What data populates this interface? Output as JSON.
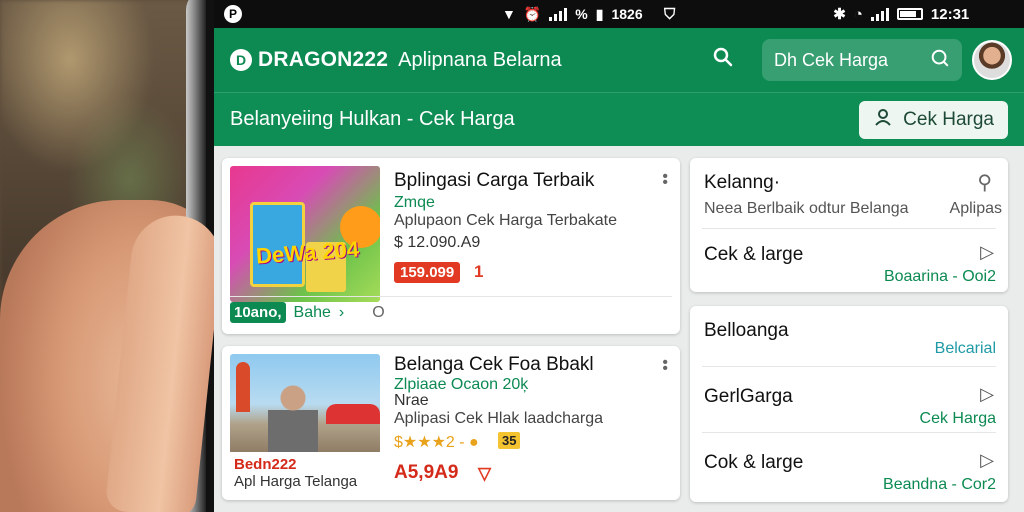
{
  "status": {
    "left_icon": "p-app-icon",
    "center_time": "1826",
    "right_time": "12:31"
  },
  "appbar": {
    "logo_letter": "D",
    "brand": "DRAGON222",
    "subtitle": "Aplipnana Belarna",
    "search_placeholder": "Dh Cek Harga"
  },
  "subbar": {
    "title": "Belanyeiing Hulkan - Cek Harga",
    "button_label": "Cek Harga"
  },
  "products": [
    {
      "title": "Bplingasi Carga Terbaik",
      "sub": "Zmqe",
      "desc": "Aplupaon Cek Harga Terbakate",
      "old_price": "$ 12.090.A9",
      "price_badge": "159.099",
      "flag": "1",
      "image_text": "DeWa 204",
      "footer_chip": "10ano,",
      "footer_link": "Bahe",
      "footer_o": "O"
    },
    {
      "title": "Belanga Cek Foa Bbakl",
      "sub1": "Zlpiaae Ocaon 20ķ",
      "sub2": "Nrae",
      "desc": "Aplipasi Cek Hlak laadcharga",
      "rating": "$★★★2 - ●",
      "rating_badge": "35",
      "price": "A5,9A9",
      "flag": "▽",
      "caption1": "Bedn222",
      "caption2": "Apl Harga Telanga"
    }
  ],
  "side_top": {
    "title": "Kelanng·",
    "sub": "Neea Berlbaik odtur Belanga",
    "sub_right": "Aplipas",
    "item": "Cek & large",
    "item_green": "Boaarina - Ooi2"
  },
  "side_bottom": {
    "title": "Belloanga",
    "title_teal": "Belcarial",
    "item1": "GerlGarga",
    "item1_green": "Cek Harga",
    "item2": "Cok & large",
    "item2_green": "Beandna - Cor2"
  },
  "colors": {
    "brand_green": "#0c8a52",
    "price_red": "#d42a1a"
  }
}
